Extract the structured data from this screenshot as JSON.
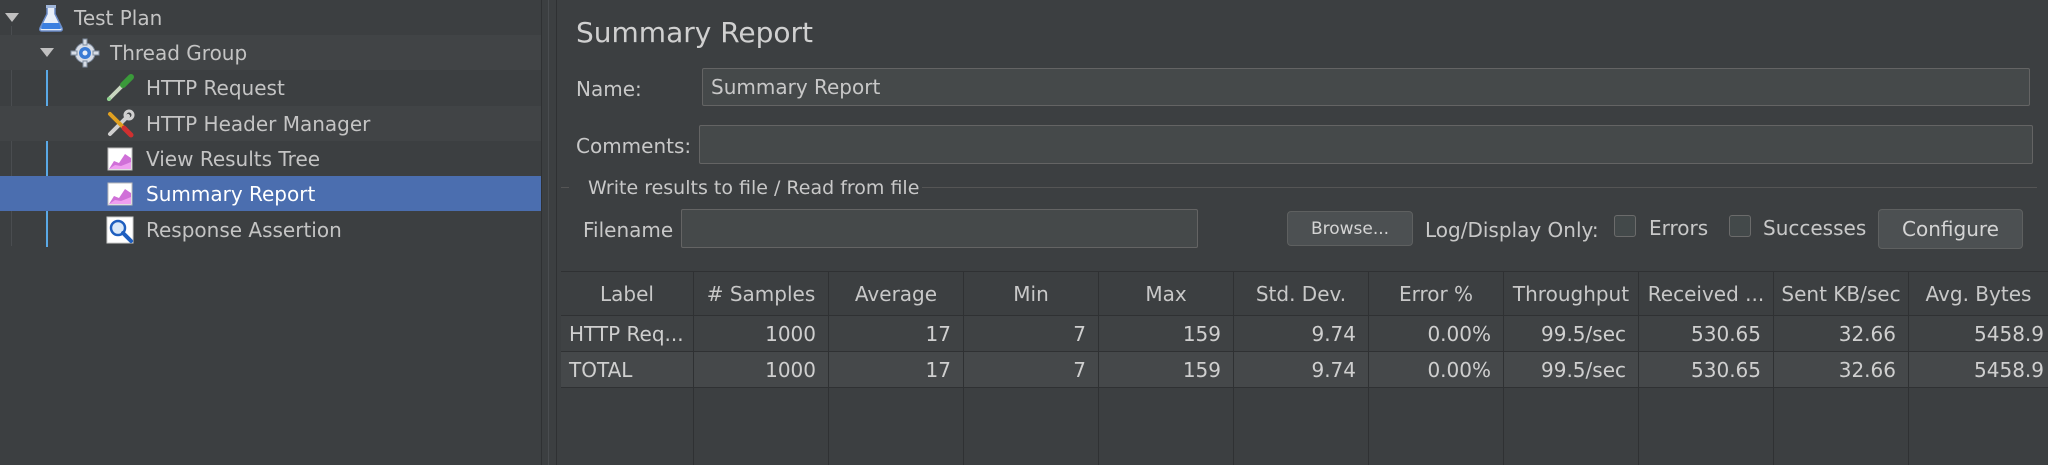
{
  "tree": {
    "items": [
      {
        "label": "Test Plan",
        "icon": "flask-icon"
      },
      {
        "label": "Thread Group",
        "icon": "gear-icon"
      },
      {
        "label": "HTTP Request",
        "icon": "pipette-icon"
      },
      {
        "label": "HTTP Header Manager",
        "icon": "wrench-screwdriver-icon"
      },
      {
        "label": "View Results Tree",
        "icon": "chart-icon"
      },
      {
        "label": "Summary Report",
        "icon": "chart-icon"
      },
      {
        "label": "Response Assertion",
        "icon": "magnifier-icon"
      }
    ],
    "selected": "Summary Report"
  },
  "panel": {
    "title": "Summary Report",
    "name_label": "Name:",
    "name_value": "Summary Report",
    "comments_label": "Comments:",
    "comments_value": "",
    "file_group_title": "Write results to file / Read from file",
    "filename_label": "Filename",
    "filename_value": "",
    "browse_label": "Browse...",
    "log_display_label": "Log/Display Only:",
    "errors_label": "Errors",
    "successes_label": "Successes",
    "configure_label": "Configure"
  },
  "table": {
    "headers": [
      "Label",
      "# Samples",
      "Average",
      "Min",
      "Max",
      "Std. Dev.",
      "Error %",
      "Throughput",
      "Received ...",
      "Sent KB/sec",
      "Avg. Bytes"
    ],
    "rows": [
      [
        "HTTP Req...",
        "1000",
        "17",
        "7",
        "159",
        "9.74",
        "0.00%",
        "99.5/sec",
        "530.65",
        "32.66",
        "5458.9"
      ],
      [
        "TOTAL",
        "1000",
        "17",
        "7",
        "159",
        "9.74",
        "0.00%",
        "99.5/sec",
        "530.65",
        "32.66",
        "5458.9"
      ]
    ]
  },
  "colors": {
    "background": "#3c3f41",
    "selection": "#4b6eaf",
    "tree_line": "#5aa9e6"
  }
}
